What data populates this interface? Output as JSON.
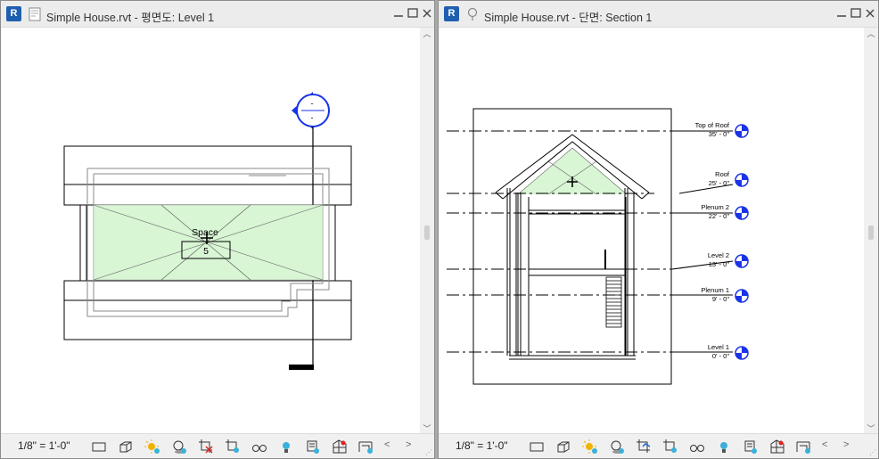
{
  "left_view": {
    "title": "Simple House.rvt - 평면도: Level 1",
    "space_name": "Space",
    "space_number": "5",
    "elevation_marker_label": "-",
    "scale": "1/8\" = 1'-0\""
  },
  "right_view": {
    "title": "Simple House.rvt - 단면: Section 1",
    "scale": "1/8\" = 1'-0\"",
    "levels": [
      {
        "name": "Top of Roof",
        "elevation": "35' - 0\""
      },
      {
        "name": "Roof",
        "elevation": "25' - 0\""
      },
      {
        "name": "Plenum 2",
        "elevation": "22' - 0\""
      },
      {
        "name": "Level 2",
        "elevation": "13' - 0\""
      },
      {
        "name": "Plenum 1",
        "elevation": "9' - 0\""
      },
      {
        "name": "Level 1",
        "elevation": "0' - 0\""
      }
    ]
  },
  "app_icon_letter": "R",
  "colors": {
    "space_fill": "#d8f5d4",
    "marker_blue": "#1a33e6",
    "titlebar": "#ececec",
    "app_icon": "#1f5fb0"
  }
}
